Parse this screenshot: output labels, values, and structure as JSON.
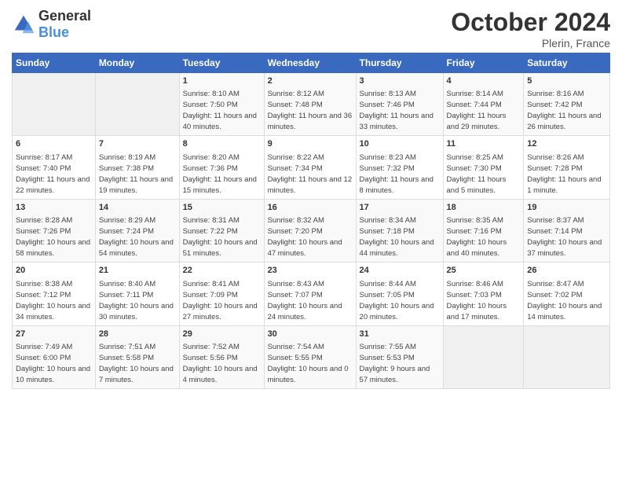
{
  "header": {
    "logo": {
      "general": "General",
      "blue": "Blue"
    },
    "title": "October 2024",
    "location": "Plerin, France"
  },
  "days_of_week": [
    "Sunday",
    "Monday",
    "Tuesday",
    "Wednesday",
    "Thursday",
    "Friday",
    "Saturday"
  ],
  "weeks": [
    [
      {
        "day": "",
        "sunrise": "",
        "sunset": "",
        "daylight": "",
        "empty": true
      },
      {
        "day": "",
        "sunrise": "",
        "sunset": "",
        "daylight": "",
        "empty": true
      },
      {
        "day": "1",
        "sunrise": "Sunrise: 8:10 AM",
        "sunset": "Sunset: 7:50 PM",
        "daylight": "Daylight: 11 hours and 40 minutes."
      },
      {
        "day": "2",
        "sunrise": "Sunrise: 8:12 AM",
        "sunset": "Sunset: 7:48 PM",
        "daylight": "Daylight: 11 hours and 36 minutes."
      },
      {
        "day": "3",
        "sunrise": "Sunrise: 8:13 AM",
        "sunset": "Sunset: 7:46 PM",
        "daylight": "Daylight: 11 hours and 33 minutes."
      },
      {
        "day": "4",
        "sunrise": "Sunrise: 8:14 AM",
        "sunset": "Sunset: 7:44 PM",
        "daylight": "Daylight: 11 hours and 29 minutes."
      },
      {
        "day": "5",
        "sunrise": "Sunrise: 8:16 AM",
        "sunset": "Sunset: 7:42 PM",
        "daylight": "Daylight: 11 hours and 26 minutes."
      }
    ],
    [
      {
        "day": "6",
        "sunrise": "Sunrise: 8:17 AM",
        "sunset": "Sunset: 7:40 PM",
        "daylight": "Daylight: 11 hours and 22 minutes."
      },
      {
        "day": "7",
        "sunrise": "Sunrise: 8:19 AM",
        "sunset": "Sunset: 7:38 PM",
        "daylight": "Daylight: 11 hours and 19 minutes."
      },
      {
        "day": "8",
        "sunrise": "Sunrise: 8:20 AM",
        "sunset": "Sunset: 7:36 PM",
        "daylight": "Daylight: 11 hours and 15 minutes."
      },
      {
        "day": "9",
        "sunrise": "Sunrise: 8:22 AM",
        "sunset": "Sunset: 7:34 PM",
        "daylight": "Daylight: 11 hours and 12 minutes."
      },
      {
        "day": "10",
        "sunrise": "Sunrise: 8:23 AM",
        "sunset": "Sunset: 7:32 PM",
        "daylight": "Daylight: 11 hours and 8 minutes."
      },
      {
        "day": "11",
        "sunrise": "Sunrise: 8:25 AM",
        "sunset": "Sunset: 7:30 PM",
        "daylight": "Daylight: 11 hours and 5 minutes."
      },
      {
        "day": "12",
        "sunrise": "Sunrise: 8:26 AM",
        "sunset": "Sunset: 7:28 PM",
        "daylight": "Daylight: 11 hours and 1 minute."
      }
    ],
    [
      {
        "day": "13",
        "sunrise": "Sunrise: 8:28 AM",
        "sunset": "Sunset: 7:26 PM",
        "daylight": "Daylight: 10 hours and 58 minutes."
      },
      {
        "day": "14",
        "sunrise": "Sunrise: 8:29 AM",
        "sunset": "Sunset: 7:24 PM",
        "daylight": "Daylight: 10 hours and 54 minutes."
      },
      {
        "day": "15",
        "sunrise": "Sunrise: 8:31 AM",
        "sunset": "Sunset: 7:22 PM",
        "daylight": "Daylight: 10 hours and 51 minutes."
      },
      {
        "day": "16",
        "sunrise": "Sunrise: 8:32 AM",
        "sunset": "Sunset: 7:20 PM",
        "daylight": "Daylight: 10 hours and 47 minutes."
      },
      {
        "day": "17",
        "sunrise": "Sunrise: 8:34 AM",
        "sunset": "Sunset: 7:18 PM",
        "daylight": "Daylight: 10 hours and 44 minutes."
      },
      {
        "day": "18",
        "sunrise": "Sunrise: 8:35 AM",
        "sunset": "Sunset: 7:16 PM",
        "daylight": "Daylight: 10 hours and 40 minutes."
      },
      {
        "day": "19",
        "sunrise": "Sunrise: 8:37 AM",
        "sunset": "Sunset: 7:14 PM",
        "daylight": "Daylight: 10 hours and 37 minutes."
      }
    ],
    [
      {
        "day": "20",
        "sunrise": "Sunrise: 8:38 AM",
        "sunset": "Sunset: 7:12 PM",
        "daylight": "Daylight: 10 hours and 34 minutes."
      },
      {
        "day": "21",
        "sunrise": "Sunrise: 8:40 AM",
        "sunset": "Sunset: 7:11 PM",
        "daylight": "Daylight: 10 hours and 30 minutes."
      },
      {
        "day": "22",
        "sunrise": "Sunrise: 8:41 AM",
        "sunset": "Sunset: 7:09 PM",
        "daylight": "Daylight: 10 hours and 27 minutes."
      },
      {
        "day": "23",
        "sunrise": "Sunrise: 8:43 AM",
        "sunset": "Sunset: 7:07 PM",
        "daylight": "Daylight: 10 hours and 24 minutes."
      },
      {
        "day": "24",
        "sunrise": "Sunrise: 8:44 AM",
        "sunset": "Sunset: 7:05 PM",
        "daylight": "Daylight: 10 hours and 20 minutes."
      },
      {
        "day": "25",
        "sunrise": "Sunrise: 8:46 AM",
        "sunset": "Sunset: 7:03 PM",
        "daylight": "Daylight: 10 hours and 17 minutes."
      },
      {
        "day": "26",
        "sunrise": "Sunrise: 8:47 AM",
        "sunset": "Sunset: 7:02 PM",
        "daylight": "Daylight: 10 hours and 14 minutes."
      }
    ],
    [
      {
        "day": "27",
        "sunrise": "Sunrise: 7:49 AM",
        "sunset": "Sunset: 6:00 PM",
        "daylight": "Daylight: 10 hours and 10 minutes."
      },
      {
        "day": "28",
        "sunrise": "Sunrise: 7:51 AM",
        "sunset": "Sunset: 5:58 PM",
        "daylight": "Daylight: 10 hours and 7 minutes."
      },
      {
        "day": "29",
        "sunrise": "Sunrise: 7:52 AM",
        "sunset": "Sunset: 5:56 PM",
        "daylight": "Daylight: 10 hours and 4 minutes."
      },
      {
        "day": "30",
        "sunrise": "Sunrise: 7:54 AM",
        "sunset": "Sunset: 5:55 PM",
        "daylight": "Daylight: 10 hours and 0 minutes."
      },
      {
        "day": "31",
        "sunrise": "Sunrise: 7:55 AM",
        "sunset": "Sunset: 5:53 PM",
        "daylight": "Daylight: 9 hours and 57 minutes."
      },
      {
        "day": "",
        "sunrise": "",
        "sunset": "",
        "daylight": "",
        "empty": true
      },
      {
        "day": "",
        "sunrise": "",
        "sunset": "",
        "daylight": "",
        "empty": true
      }
    ]
  ]
}
